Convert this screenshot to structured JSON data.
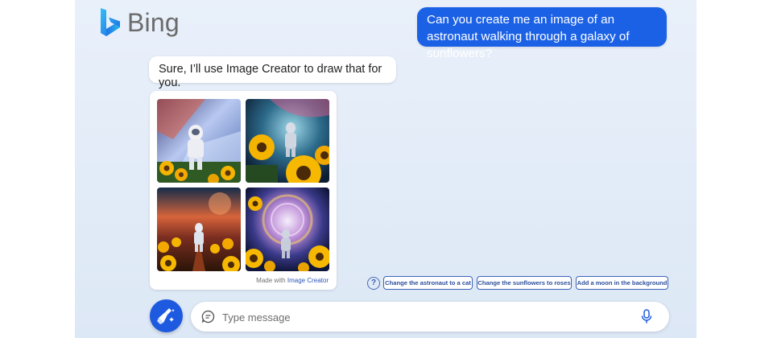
{
  "brand": {
    "name": "Bing",
    "accent": "#1b61e6"
  },
  "conversation": {
    "user_message": "Can you create me an image of an astronaut walking through a galaxy of sunflowers?",
    "bot_message": "Sure, I’ll use Image Creator to draw that for you."
  },
  "image_card": {
    "images": [
      "astronaut-image-1",
      "astronaut-image-2",
      "astronaut-image-3",
      "astronaut-image-4"
    ],
    "footer_prefix": "Made with",
    "footer_link": "Image Creator"
  },
  "suggestions": [
    "Change the astronaut to a cat",
    "Change the sunflowers to roses",
    "Add a moon in the background"
  ],
  "composer": {
    "placeholder": "Type message",
    "new_topic_icon": "broom-icon",
    "chat_icon": "chat-bubble-icon",
    "mic_icon": "microphone-icon",
    "help_icon": "question-icon"
  }
}
